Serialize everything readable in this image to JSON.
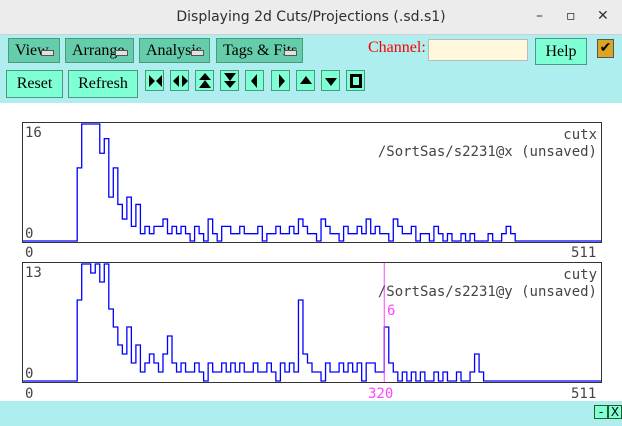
{
  "window": {
    "title": "Displaying 2d Cuts/Projections (.sd.s1)",
    "minimize": "–",
    "maximize": "▫",
    "close": "✕"
  },
  "menus": [
    {
      "label": "View"
    },
    {
      "label": "Arrange"
    },
    {
      "label": "Analysis"
    },
    {
      "label": "Tags & Fits"
    }
  ],
  "channel": {
    "label": "Channel:",
    "value": ""
  },
  "help_label": "Help",
  "check": "✔",
  "reset_label": "Reset",
  "refresh_label": "Refresh",
  "nav_icons": [
    "expand-horizontal-icon",
    "contract-horizontal-icon",
    "expand-vertical-icon",
    "contract-vertical-icon",
    "scroll-left-icon",
    "scroll-right-icon",
    "scale-up-icon",
    "scale-down-icon",
    "full-view-icon"
  ],
  "colors": {
    "histogram": "#0000ff",
    "marker": "#ff44ff"
  },
  "bottom": {
    "minimize": "-",
    "close": "X"
  },
  "chart_data": [
    {
      "type": "line",
      "name": "cutx",
      "path": "/SortSas/s2231@x (unsaved)",
      "xlim": [
        0,
        511
      ],
      "ylim": [
        0,
        16
      ],
      "x_tick_labels": [
        "0",
        "511"
      ],
      "y_tick_labels": [
        "0",
        "16"
      ],
      "bin_width": 4,
      "values": [
        0,
        0,
        0,
        0,
        0,
        0,
        0,
        0,
        0,
        0,
        0,
        0,
        10,
        16,
        16,
        16,
        16,
        12,
        14,
        6,
        10,
        5,
        3,
        6,
        2,
        5,
        1,
        2,
        1,
        2,
        2,
        3,
        1,
        2,
        1,
        2,
        1,
        0,
        2,
        1,
        0,
        3,
        1,
        0,
        2,
        2,
        1,
        1,
        2,
        1,
        1,
        1,
        2,
        0,
        1,
        1,
        2,
        1,
        1,
        2,
        1,
        3,
        2,
        1,
        1,
        0,
        3,
        2,
        1,
        1,
        0,
        2,
        1,
        1,
        2,
        1,
        3,
        1,
        2,
        1,
        1,
        0,
        3,
        2,
        1,
        1,
        2,
        0,
        1,
        1,
        0,
        2,
        1,
        0,
        1,
        0,
        0,
        1,
        0,
        1,
        0,
        0,
        0,
        1,
        0,
        0,
        1,
        2,
        1,
        0,
        0,
        0,
        0,
        0,
        0,
        0,
        0,
        0,
        0,
        0,
        0,
        0,
        0,
        0,
        0,
        0,
        0,
        0
      ]
    },
    {
      "type": "line",
      "name": "cuty",
      "path": "/SortSas/s2231@y (unsaved)",
      "xlim": [
        0,
        511
      ],
      "ylim": [
        0,
        13
      ],
      "x_tick_labels": [
        "0",
        "511"
      ],
      "y_tick_labels": [
        "0",
        "13"
      ],
      "bin_width": 4,
      "marker": {
        "channel": "320",
        "value": "6"
      },
      "values": [
        0,
        0,
        0,
        0,
        0,
        0,
        0,
        0,
        0,
        0,
        0,
        0,
        9,
        13,
        13,
        12,
        13,
        11,
        13,
        8,
        6,
        4,
        3,
        6,
        2,
        4,
        1,
        2,
        3,
        2,
        1,
        3,
        5,
        2,
        1,
        2,
        1,
        1,
        2,
        1,
        0,
        2,
        1,
        1,
        2,
        1,
        2,
        1,
        2,
        1,
        1,
        2,
        1,
        1,
        2,
        1,
        0,
        2,
        1,
        2,
        1,
        9,
        3,
        2,
        1,
        1,
        0,
        2,
        1,
        1,
        2,
        1,
        2,
        1,
        2,
        0,
        2,
        2,
        1,
        1,
        6,
        2,
        1,
        0,
        1,
        0,
        1,
        0,
        1,
        0,
        0,
        1,
        0,
        1,
        0,
        0,
        1,
        0,
        0,
        1,
        3,
        1,
        0,
        0,
        0,
        0,
        0,
        0,
        0,
        0,
        0,
        0,
        0,
        0,
        0,
        0,
        0,
        0,
        0,
        0,
        0,
        0,
        0,
        0,
        0,
        0,
        0,
        0
      ]
    }
  ]
}
